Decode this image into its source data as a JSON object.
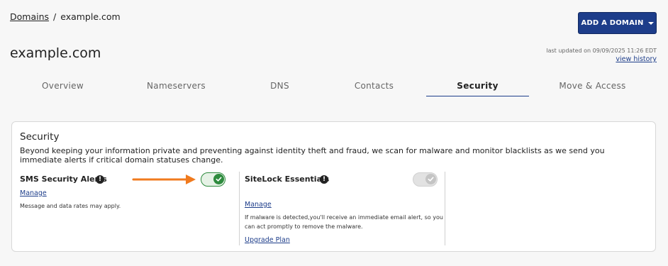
{
  "breadcrumb": {
    "root": "Domains",
    "separator": "/",
    "current": "example.com"
  },
  "header": {
    "add_button": "ADD A DOMAIN",
    "title": "example.com",
    "last_updated": "last updated on 09/09/2025 11:26 EDT",
    "history_link": "view history"
  },
  "tabs": [
    {
      "label": "Overview"
    },
    {
      "label": "Nameservers"
    },
    {
      "label": "DNS"
    },
    {
      "label": "Contacts"
    },
    {
      "label": "Security",
      "active": true
    },
    {
      "label": "Move & Access"
    }
  ],
  "security": {
    "title": "Security",
    "description": "Beyond keeping your information private and preventing against identity theft and fraud, we scan for malware and monitor blacklists as we send you immediate alerts if critical domain statuses change.",
    "sms": {
      "title": "SMS Security Alerts",
      "info_glyph": "!",
      "enabled": true,
      "manage": "Manage",
      "note": "Message and data rates may apply."
    },
    "sitelock": {
      "title": "SiteLock Essentials",
      "info_glyph": "!",
      "enabled": false,
      "manage": "Manage",
      "note": "If malware is detected,you'll receive an immediate email alert, so you can act promptly to remove the malware.",
      "upgrade": "Upgrade Plan"
    }
  },
  "colors": {
    "brand": "#1d3d8a",
    "toggle_on": "#2e8b3e",
    "annotation_arrow": "#f07a1e"
  },
  "icons": {
    "info": "exclamation-circle-icon",
    "check": "check-icon",
    "caret": "caret-down-icon",
    "arrow": "arrow-right-icon"
  }
}
